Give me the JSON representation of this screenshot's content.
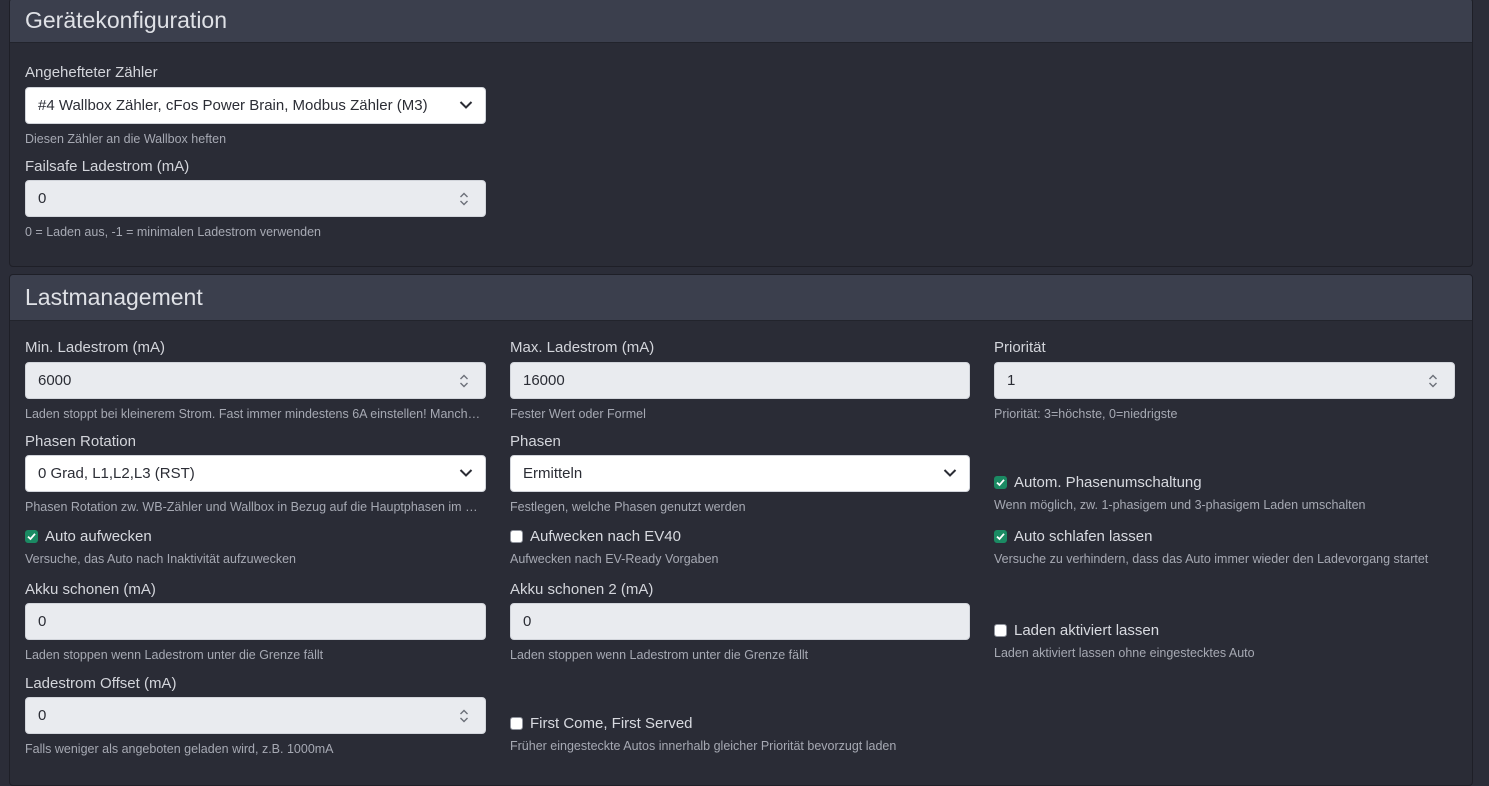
{
  "device_config": {
    "title": "Gerätekonfiguration",
    "meter": {
      "label": "Angehefteter Zähler",
      "value": "#4 Wallbox Zähler, cFos Power Brain, Modbus Zähler (M3)",
      "help": "Diesen Zähler an die Wallbox heften"
    },
    "failsafe": {
      "label": "Failsafe Ladestrom (mA)",
      "value": "0",
      "help": "0 = Laden aus, -1 = minimalen Ladestrom verwenden"
    }
  },
  "load_mgmt": {
    "title": "Lastmanagement",
    "min_current": {
      "label": "Min. Ladestrom (mA)",
      "value": "6000",
      "help": "Laden stoppt bei kleinerem Strom. Fast immer mindestens 6A einstellen! Manche Fahrzeuge benötigen mehr."
    },
    "max_current": {
      "label": "Max. Ladestrom (mA)",
      "value": "16000",
      "help": "Fester Wert oder Formel"
    },
    "priority": {
      "label": "Priorität",
      "value": "1",
      "help": "Priorität: 3=höchste, 0=niedrigste"
    },
    "phase_rotation": {
      "label": "Phasen Rotation",
      "value": "0 Grad, L1,L2,L3 (RST)",
      "help": "Phasen Rotation zw. WB-Zähler und Wallbox in Bezug auf die Hauptphasen im Haus"
    },
    "phases": {
      "label": "Phasen",
      "value": "Ermitteln",
      "help": "Festlegen, welche Phasen genutzt werden"
    },
    "auto_phase_switch": {
      "label": "Autom. Phasenumschaltung",
      "checked": true,
      "help": "Wenn möglich, zw. 1-phasigem und 3-phasigem Laden umschalten"
    },
    "auto_wake": {
      "label": "Auto aufwecken",
      "checked": true,
      "help": "Versuche, das Auto nach Inaktivität aufzuwecken"
    },
    "wake_ev40": {
      "label": "Aufwecken nach EV40",
      "checked": false,
      "help": "Aufwecken nach EV-Ready Vorgaben"
    },
    "auto_sleep": {
      "label": "Auto schlafen lassen",
      "checked": true,
      "help": "Versuche zu verhindern, dass das Auto immer wieder den Ladevorgang startet"
    },
    "battery_save": {
      "label": "Akku schonen (mA)",
      "value": "0",
      "help": "Laden stoppen wenn Ladestrom unter die Grenze fällt"
    },
    "battery_save2": {
      "label": "Akku schonen 2 (mA)",
      "value": "0",
      "help": "Laden stoppen wenn Ladestrom unter die Grenze fällt"
    },
    "keep_enabled": {
      "label": "Laden aktiviert lassen",
      "checked": false,
      "help": "Laden aktiviert lassen ohne eingestecktes Auto"
    },
    "offset": {
      "label": "Ladestrom Offset (mA)",
      "value": "0",
      "help": "Falls weniger als angeboten geladen wird, z.B. 1000mA"
    },
    "fcfs": {
      "label": "First Come, First Served",
      "checked": false,
      "help": "Früher eingesteckte Autos innerhalb gleicher Priorität bevorzugt laden"
    }
  },
  "icons": {
    "chevron": "chevron-down-icon",
    "spinner": "spinner-arrows-icon",
    "check": "checkmark-icon"
  },
  "colors": {
    "checkbox_on": "#1b8a63",
    "header_bg": "#3b3f4d",
    "page_bg": "#2b2d38"
  }
}
